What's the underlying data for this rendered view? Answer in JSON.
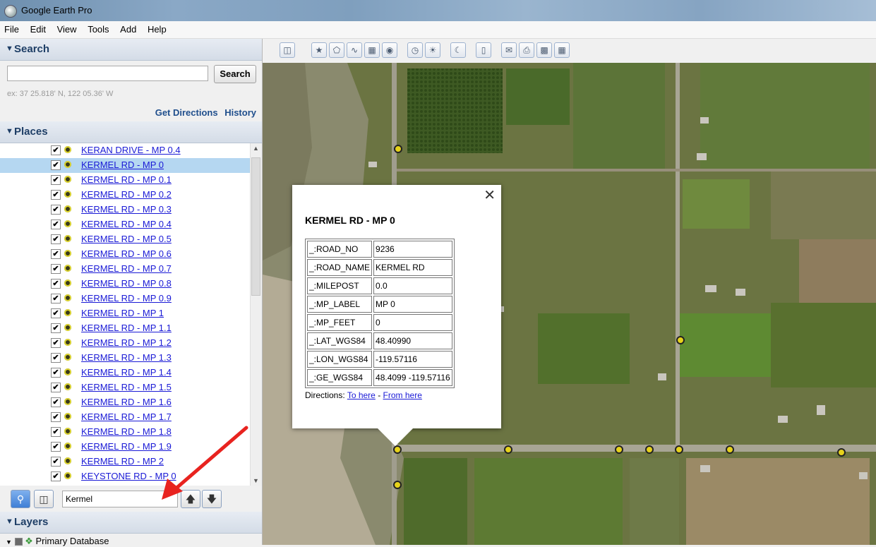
{
  "window": {
    "title": "Google Earth Pro"
  },
  "menu": [
    "File",
    "Edit",
    "View",
    "Tools",
    "Add",
    "Help"
  ],
  "search": {
    "header": "Search",
    "input_value": "",
    "button_label": "Search",
    "hint": "ex: 37 25.818' N, 122 05.36' W",
    "get_directions": "Get Directions",
    "history": "History"
  },
  "places": {
    "header": "Places",
    "items": [
      "KERAN DRIVE - MP 0.4",
      "KERMEL RD - MP 0",
      "KERMEL RD - MP 0.1",
      "KERMEL RD - MP 0.2",
      "KERMEL RD - MP 0.3",
      "KERMEL RD - MP 0.4",
      "KERMEL RD - MP 0.5",
      "KERMEL RD - MP 0.6",
      "KERMEL RD - MP 0.7",
      "KERMEL RD - MP 0.8",
      "KERMEL RD - MP 0.9",
      "KERMEL RD - MP 1",
      "KERMEL RD - MP 1.1",
      "KERMEL RD - MP 1.2",
      "KERMEL RD - MP 1.3",
      "KERMEL RD - MP 1.4",
      "KERMEL RD - MP 1.5",
      "KERMEL RD - MP 1.6",
      "KERMEL RD - MP 1.7",
      "KERMEL RD - MP 1.8",
      "KERMEL RD - MP 1.9",
      "KERMEL RD - MP 2",
      "KEYSTONE RD - MP 0"
    ],
    "selected_index": 1,
    "filter_value": "Kermel"
  },
  "layers": {
    "header": "Layers",
    "primary": "Primary Database"
  },
  "popup": {
    "title": "KERMEL RD - MP 0",
    "rows": [
      {
        "key": "_:ROAD_NO",
        "value": "9236"
      },
      {
        "key": "_:ROAD_NAME",
        "value": "KERMEL RD"
      },
      {
        "key": "_:MILEPOST",
        "value": "0.0"
      },
      {
        "key": "_:MP_LABEL",
        "value": "MP 0"
      },
      {
        "key": "_:MP_FEET",
        "value": "0"
      },
      {
        "key": "_:LAT_WGS84",
        "value": "48.40990"
      },
      {
        "key": "_:LON_WGS84",
        "value": "-119.57116"
      },
      {
        "key": "_:GE_WGS84",
        "value": "48.4099 -119.57116"
      }
    ],
    "directions_label": "Directions:",
    "to_here": "To here",
    "separator": "-",
    "from_here": "From here"
  },
  "colors": {
    "link": "#1a1ad6",
    "selection": "#b5d7f1",
    "section_header_text": "#1e3e66",
    "annotation_arrow": "#e8231f"
  }
}
